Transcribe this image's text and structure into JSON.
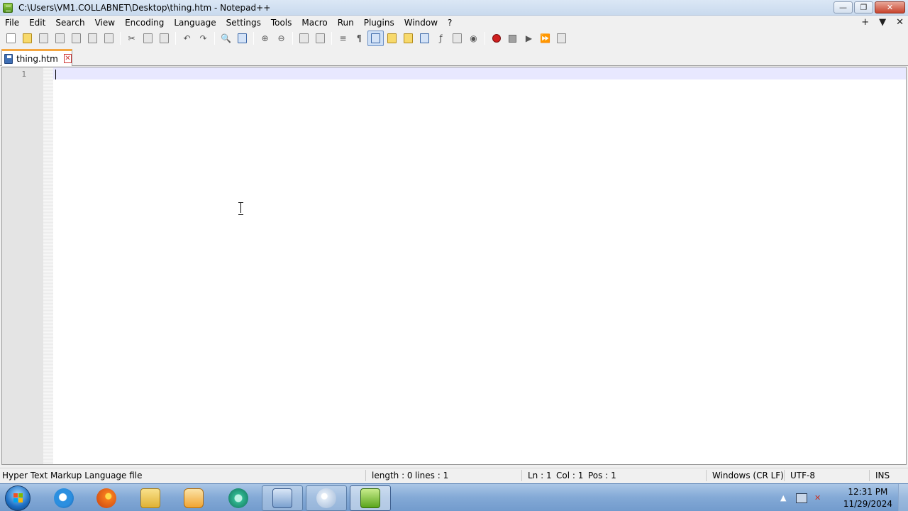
{
  "window": {
    "title": "C:\\Users\\VM1.COLLABNET\\Desktop\\thing.htm - Notepad++",
    "controls": {
      "minimize": "—",
      "restore": "❐",
      "close": "✕"
    }
  },
  "menu": {
    "items": [
      "File",
      "Edit",
      "Search",
      "View",
      "Encoding",
      "Language",
      "Settings",
      "Tools",
      "Macro",
      "Run",
      "Plugins",
      "Window",
      "?"
    ],
    "right": {
      "add": "+",
      "dropdown": "▼",
      "close": "✕"
    }
  },
  "tabs": [
    {
      "label": "thing.htm",
      "close": "✕"
    }
  ],
  "editor": {
    "line_numbers": [
      "1"
    ],
    "content": ""
  },
  "status": {
    "file_type": "Hyper Text Markup Language file",
    "length": "length : 0",
    "lines": "lines : 1",
    "ln": "Ln : 1",
    "col": "Col : 1",
    "pos": "Pos : 1",
    "eol": "Windows (CR LF)",
    "encoding": "UTF-8",
    "mode": "INS"
  },
  "taskbar": {
    "clock_time": "12:31 PM",
    "clock_date": "11/29/2024",
    "tray_arrow": "▲"
  },
  "colors": {
    "tab_accent": "#f4a640",
    "current_line": "#e8e8ff",
    "gutter": "#e4e4e4"
  }
}
